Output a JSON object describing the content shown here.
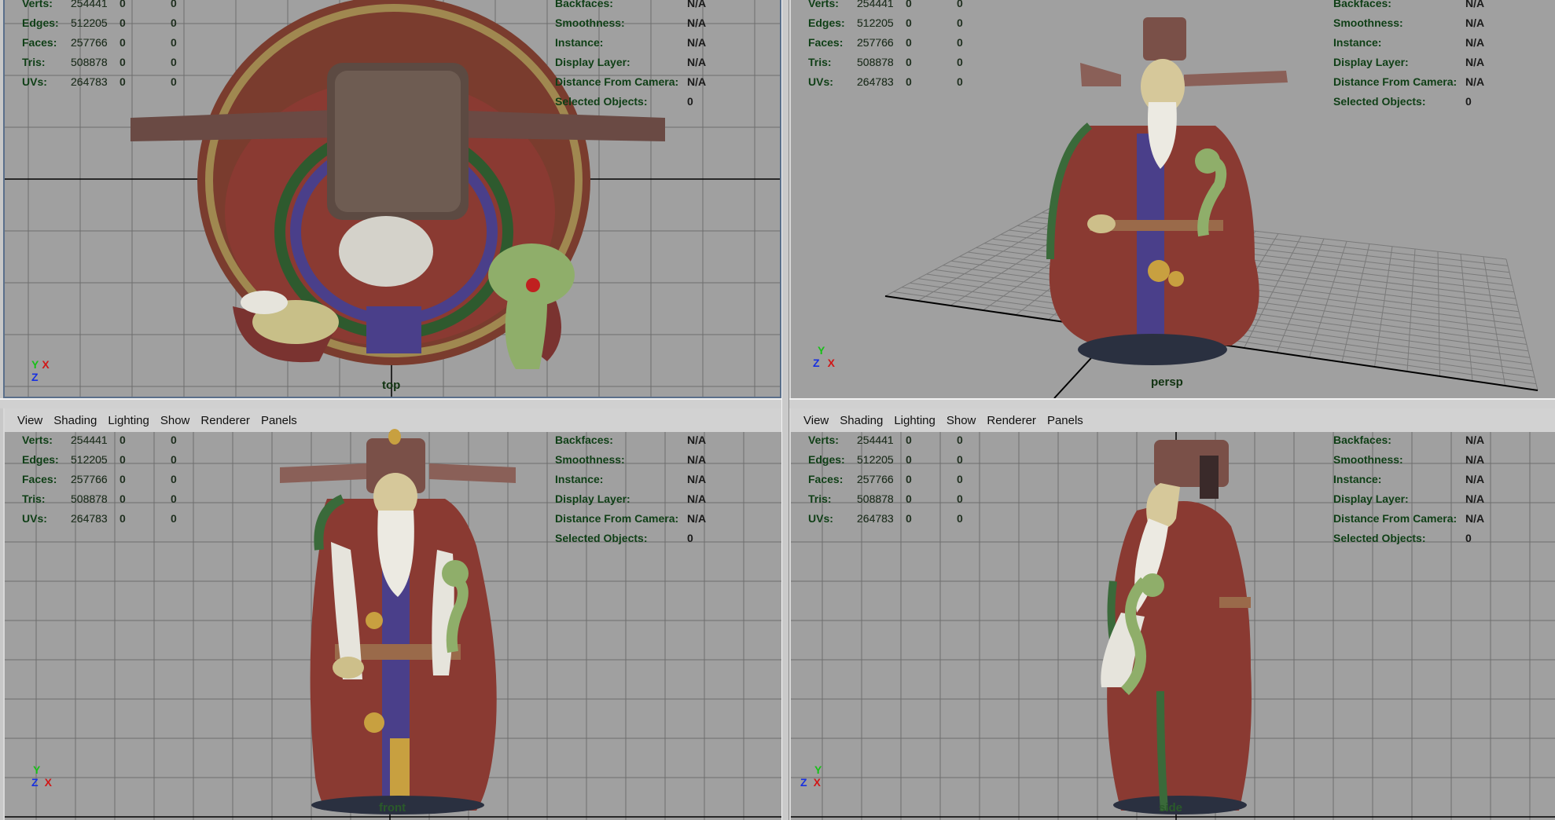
{
  "menu": {
    "view": "View",
    "shading": "Shading",
    "lighting": "Lighting",
    "show": "Show",
    "renderer": "Renderer",
    "panels": "Panels"
  },
  "hud_left": [
    {
      "label": "Verts:",
      "v1": "254441",
      "v2": "0",
      "v3": "0"
    },
    {
      "label": "Edges:",
      "v1": "512205",
      "v2": "0",
      "v3": "0"
    },
    {
      "label": "Faces:",
      "v1": "257766",
      "v2": "0",
      "v3": "0"
    },
    {
      "label": "Tris:",
      "v1": "508878",
      "v2": "0",
      "v3": "0"
    },
    {
      "label": "UVs:",
      "v1": "264783",
      "v2": "0",
      "v3": "0"
    }
  ],
  "hud_right": [
    {
      "label": "Backfaces:",
      "value": "N/A"
    },
    {
      "label": "Smoothness:",
      "value": "N/A"
    },
    {
      "label": "Instance:",
      "value": "N/A"
    },
    {
      "label": "Display Layer:",
      "value": "N/A"
    },
    {
      "label": "Distance From Camera:",
      "value": "N/A"
    },
    {
      "label": "Selected Objects:",
      "value": "0"
    }
  ],
  "viewports": {
    "top": {
      "camera": "top",
      "axes": [
        "Y",
        "X",
        "Z"
      ]
    },
    "persp": {
      "camera": "persp",
      "axes": [
        "Y",
        "Z",
        "X"
      ]
    },
    "front": {
      "camera": "front",
      "axes": [
        "Y",
        "Z",
        "X"
      ]
    },
    "side": {
      "camera": "side",
      "axes": [
        "Y",
        "Z",
        "X"
      ]
    }
  },
  "colors": {
    "viewport_bg": "#a0a0a0",
    "grid_line": "#6e6e6e",
    "grid_axis": "#000000",
    "hud_text": "#0f3f16",
    "robe": "#8a3a32",
    "robe_dark": "#5a2622",
    "sash": "#4a3f8a",
    "skin": "#cdbf8a",
    "beard": "#e8e6de",
    "hat": "#7a5048",
    "jade": "#8fae6a",
    "gold": "#c8a040",
    "trim_green": "#3a6a3a"
  }
}
